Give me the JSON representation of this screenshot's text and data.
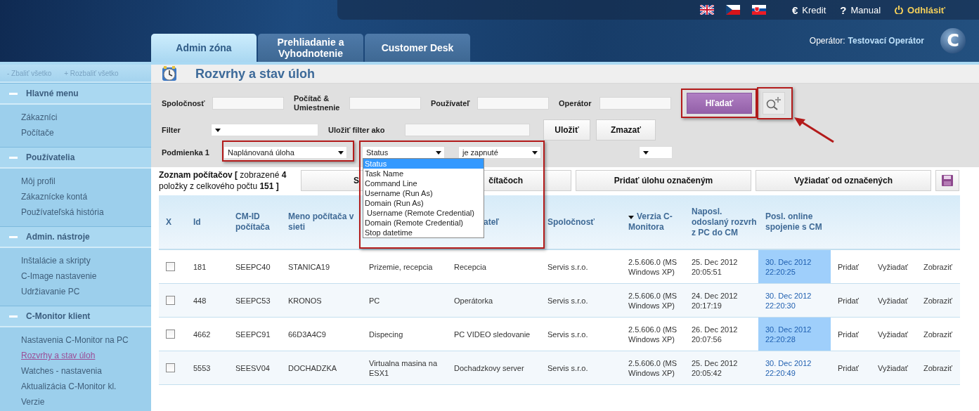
{
  "header": {
    "flags": [
      {
        "kind": "uk"
      },
      {
        "kind": "cz"
      },
      {
        "kind": "sk"
      }
    ],
    "links": [
      {
        "symbol": "€",
        "label": "Kredit"
      },
      {
        "symbol": "?",
        "label": "Manual"
      },
      {
        "kind": "logout",
        "label": "Odhlásiť"
      }
    ],
    "operator_label": "Operátor:",
    "operator_name": "Testovací Operátor",
    "logo_letter": "C"
  },
  "tabs": [
    {
      "label": "Admin zóna",
      "selected": true
    },
    {
      "label": "Prehliadanie a Vyhodnotenie",
      "selected": false
    },
    {
      "label": "Customer Desk",
      "selected": false
    }
  ],
  "sidebar": {
    "collapse_all": "- Zbaliť všetko",
    "expand_all": "+ Rozbaliť všetko",
    "sections": [
      {
        "title": "Hlavné menu",
        "expanded": true,
        "items": [
          {
            "label": "Zákazníci",
            "selected": false
          },
          {
            "label": "Počítače",
            "selected": false
          }
        ]
      },
      {
        "title": "Používatelia",
        "expanded": true,
        "items": [
          {
            "label": "Môj profil",
            "selected": false
          },
          {
            "label": "Zákaznícke kontá",
            "selected": false
          },
          {
            "label": "Používateľská história",
            "selected": false
          }
        ]
      },
      {
        "title": "Admin. nástroje",
        "expanded": true,
        "items": [
          {
            "label": "Inštalácie a skripty",
            "selected": false
          },
          {
            "label": "C-Image nastavenie",
            "selected": false
          },
          {
            "label": "Udržiavanie PC",
            "selected": false
          }
        ]
      },
      {
        "title": "C-Monitor klient",
        "expanded": true,
        "items": [
          {
            "label": "Nastavenia C-Monitor na PC",
            "selected": false
          },
          {
            "label": "Rozvrhy a stav úloh",
            "selected": true
          },
          {
            "label": "Watches - nastavenia",
            "selected": false
          },
          {
            "label": "Aktualizácia C-Monitor kl.",
            "selected": false
          },
          {
            "label": "Verzie",
            "selected": false
          }
        ]
      }
    ]
  },
  "page_title": "Rozvrhy a stav úloh",
  "filters": {
    "fields": [
      {
        "label": "Spoločnosť"
      },
      {
        "label": "Počítač & Umiestnenie"
      },
      {
        "label": "Používateľ"
      },
      {
        "label": "Operátor"
      }
    ],
    "search_button": "Hľadať",
    "filter_label": "Filter",
    "save_filter_label": "Uložiť filter ako",
    "save_button": "Uložiť",
    "delete_button": "Zmazať",
    "condition_label": "Podmienka 1",
    "condition_selects": [
      {
        "value": "Naplánovaná úloha"
      },
      {
        "value": "Status"
      },
      {
        "value": "je zapnuté"
      }
    ],
    "dropdown_options": [
      {
        "label": "Status",
        "selected": true
      },
      {
        "label": "Task Name",
        "selected": false
      },
      {
        "label": "Command Line",
        "selected": false
      },
      {
        "label": "Username (Run As)",
        "selected": false
      },
      {
        "label": "Domain (Run As)",
        "selected": false
      },
      {
        "label": " Username (Remote Credential)",
        "selected": false
      },
      {
        "label": "Domain (Remote Credential)",
        "selected": false
      },
      {
        "label": "Stop datetime",
        "selected": false
      }
    ]
  },
  "list_summary": "**Zoznam počítačov [** zobrazené **4** položky z celkového počtu **151 ]**",
  "action_buttons": [
    {
      "visible_parts": [
        "S",
        "čítačoch"
      ]
    },
    {
      "label": "Pridať úlohu označeným"
    },
    {
      "label": "Vyžiadať od označených"
    }
  ],
  "table": {
    "checkbox_header": "X",
    "columns": [
      {
        "label": "Id",
        "sorted": false
      },
      {
        "label": "CM-ID počítača",
        "sorted": false
      },
      {
        "label": "Meno počítača v sieti",
        "sorted": false
      },
      null,
      {
        "label": "ateľ",
        "sorted": false
      },
      {
        "label": "Spoločnosť",
        "sorted": false
      },
      {
        "label": "Verzia C-Monitora",
        "sorted": true
      },
      {
        "label": "Naposl. odoslaný rozvrh z PC do CM",
        "sorted": false
      },
      {
        "label": "Posl. online spojenie s CM",
        "sorted": false
      }
    ],
    "rows": [
      {
        "checked": false,
        "cells": [
          "181",
          "SEEPC40",
          "STANICA19",
          "Prizemie, recepcia",
          "Recepcia",
          "Servis  s.r.o.",
          "2.5.606.0 (MS Windows XP)",
          "25. Dec 2012 20:05:51",
          "30. Dec 2012 22:20:25"
        ],
        "actions": [
          "Pridať",
          "Vyžiadať",
          "Zobraziť"
        ]
      },
      {
        "checked": false,
        "cells": [
          "448",
          "SEEPC53",
          "KRONOS",
          "PC",
          "Operátorka",
          "Servis  s.r.o.",
          "2.5.606.0 (MS Windows XP)",
          "24. Dec 2012 20:17:19",
          "30. Dec 2012 22:20:30"
        ],
        "actions": [
          "Pridať",
          "Vyžiadať",
          "Zobraziť"
        ]
      },
      {
        "checked": false,
        "cells": [
          "4662",
          "SEEPC91",
          "66D3A4C9",
          "Dispecing",
          "PC VIDEO sledovanie",
          "Servis  s.r.o.",
          "2.5.606.0 (MS Windows XP)",
          "26. Dec 2012 20:07:56",
          "30. Dec 2012 22:20:28"
        ],
        "actions": [
          "Pridať",
          "Vyžiadať",
          "Zobraziť"
        ]
      },
      {
        "checked": false,
        "cells": [
          "5553",
          "SEESV04",
          "DOCHADZKA",
          "Virtualna masina na ESX1",
          "Dochadzkovy server",
          "Servis  s.r.o.",
          "2.5.606.0 (MS Windows XP)",
          "25. Dec 2012 20:05:42",
          "30. Dec 2012 22:20:49"
        ],
        "actions": [
          "Pridať",
          "Vyžiadať",
          "Zobraziť"
        ]
      }
    ]
  }
}
